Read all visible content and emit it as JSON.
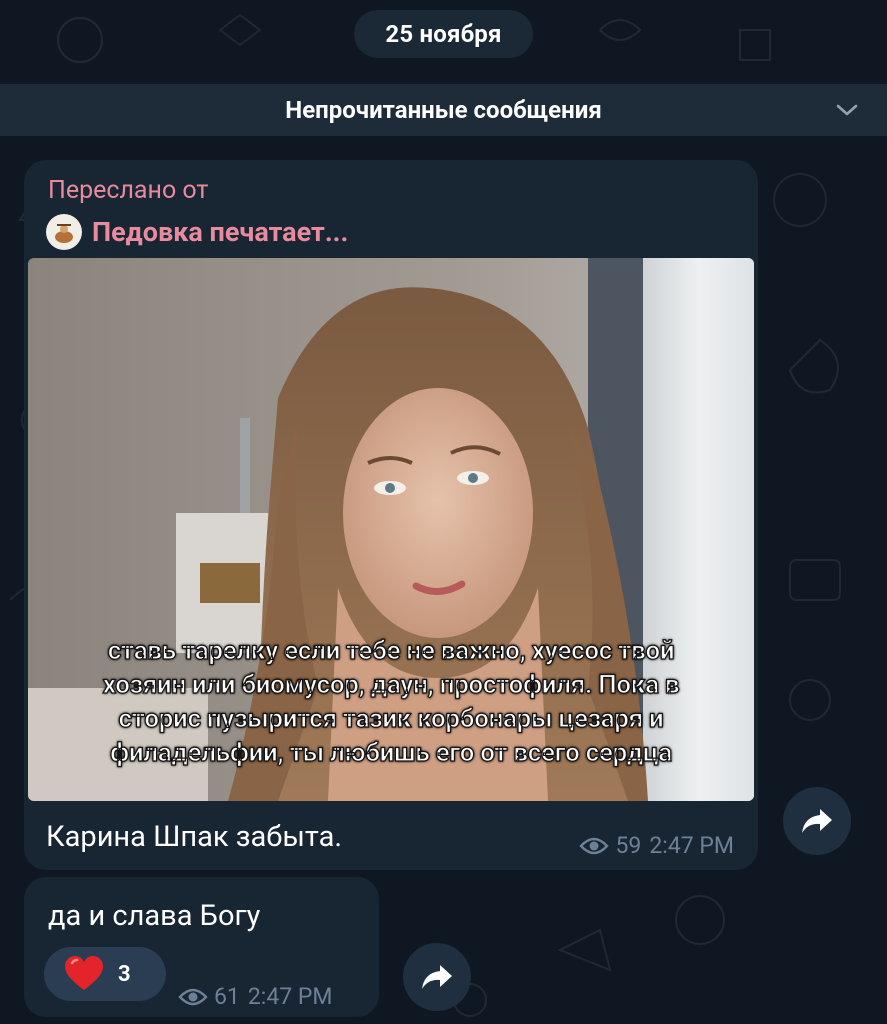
{
  "date_divider": "25 ноября",
  "unread_divider": "Непрочитанные сообщения",
  "message1": {
    "forwarded_label": "Переслано от",
    "forwarded_from": "Педовка печатает...",
    "image_caption_lines": [
      "ставь тарелку если тебе не важно, хуесос твой",
      "хозяин или биомусор, даун, простофиля. Пока в",
      "сторис пузырится тазик корбонары цезаря и",
      "филадельфии, ты любишь его от всего сердца"
    ],
    "text": "Карина Шпак забыта.",
    "views": "59",
    "time": "2:47 PM"
  },
  "message2": {
    "text": "да и слава Богу",
    "reaction_emoji": "heart",
    "reaction_count": "3",
    "views": "61",
    "time": "2:47 PM"
  },
  "colors": {
    "background": "#0f1822",
    "bubble": "#182533",
    "forward_accent": "#e88b9c",
    "meta_text": "#6d8196",
    "reaction_bg": "#2b3d52",
    "heart": "#e3242b"
  },
  "icons": {
    "unread_bar": "chevron-down-icon",
    "views": "eye-icon",
    "share": "share-arrow-icon",
    "reaction": "heart-icon"
  }
}
